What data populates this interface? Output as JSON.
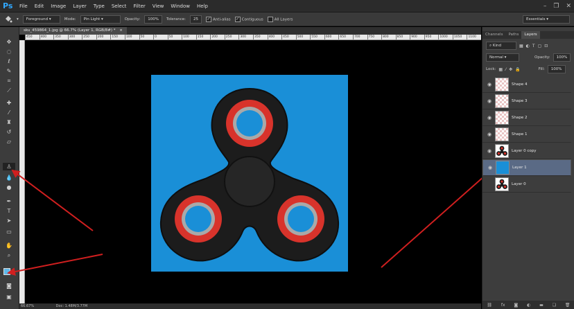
{
  "app": {
    "logo": "Ps"
  },
  "menu": [
    "File",
    "Edit",
    "Image",
    "Layer",
    "Type",
    "Select",
    "Filter",
    "View",
    "Window",
    "Help"
  ],
  "window_controls": {
    "minimize": "–",
    "restore": "❐",
    "close": "✕"
  },
  "options": {
    "preset": "Foreground",
    "mode_label": "Mode:",
    "mode_value": "Pin Light",
    "opacity_label": "Opacity:",
    "opacity_value": "100%",
    "tolerance_label": "Tolerance:",
    "tolerance_value": "25",
    "antialias_label": "Anti-alias",
    "contiguous_label": "Contiguous",
    "all_layers_label": "All Layers",
    "workspace": "Essentials"
  },
  "document": {
    "tab_title": "sku_459864_1.jpg @ 66.7% (Layer 1, RGB/8#) *",
    "close": "×"
  },
  "ruler_ticks": [
    "450",
    "400",
    "350",
    "300",
    "250",
    "200",
    "150",
    "100",
    "50",
    "0",
    "50",
    "100",
    "150",
    "200",
    "250",
    "300",
    "350",
    "400",
    "450",
    "500",
    "550",
    "600",
    "650",
    "700",
    "750",
    "800",
    "850",
    "900",
    "950",
    "1000",
    "1050",
    "1100"
  ],
  "status": {
    "zoom": "66.67%",
    "doc": "Doc: 1.48M/3.77M"
  },
  "panel": {
    "tabs": [
      "Channels",
      "Paths",
      "Layers"
    ],
    "active_tab": "Layers",
    "kind_label": "Kind",
    "blend_mode": "Normal",
    "opacity_label": "Opacity:",
    "opacity_value": "100%",
    "lock_label": "Lock:",
    "fill_label": "Fill:",
    "fill_value": "100%",
    "layers": [
      {
        "name": "Shape 4",
        "visible": true,
        "selected": false,
        "type": "shape"
      },
      {
        "name": "Shape 3",
        "visible": true,
        "selected": false,
        "type": "shape"
      },
      {
        "name": "Shape 2",
        "visible": true,
        "selected": false,
        "type": "shape"
      },
      {
        "name": "Shape 1",
        "visible": true,
        "selected": false,
        "type": "shape"
      },
      {
        "name": "Layer 0 copy",
        "visible": true,
        "selected": false,
        "type": "image"
      },
      {
        "name": "Layer 1",
        "visible": true,
        "selected": true,
        "type": "fill"
      },
      {
        "name": "Layer 0",
        "visible": false,
        "selected": false,
        "type": "image"
      }
    ],
    "bottom_icons": [
      "link-icon",
      "fx-icon",
      "mask-icon",
      "adjustment-icon",
      "folder-icon",
      "new-layer-icon",
      "trash-icon"
    ]
  },
  "colors": {
    "canvas_fill": "#1a8fd7",
    "spinner_body": "#1c1c1c",
    "bearing_red": "#d8332b",
    "annotation_arrow": "#d01f1f",
    "selected_layer": "#5a6a85"
  }
}
